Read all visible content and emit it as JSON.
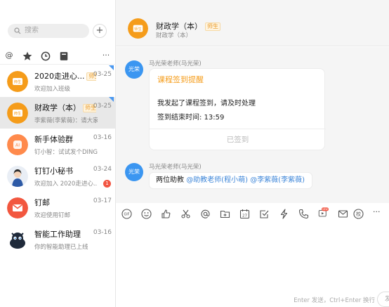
{
  "search": {
    "placeholder": "搜索"
  },
  "add_button": "+",
  "filters": {
    "more": "···"
  },
  "conversations": [
    {
      "name": "2020走进心...",
      "tag": "师生",
      "date": "03-25",
      "preview": "欢迎加入班级"
    },
    {
      "name": "财政学（本）",
      "tag": "师生",
      "date": "03-25",
      "preview": "李紫薇(李紫薇)：请大家..."
    },
    {
      "name": "新手体验群",
      "date": "03-16",
      "preview": "钉小智：试试发个DING",
      "avatar_text": "AI"
    },
    {
      "name": "钉钉小秘书",
      "date": "03-24",
      "preview": "欢迎加入 2020走进心...",
      "unread": "1"
    },
    {
      "name": "钉邮",
      "date": "03-17",
      "preview": "欢迎使用钉邮"
    },
    {
      "name": "智能工作助理",
      "date": "03-16",
      "preview": "你的智能助理已上线"
    }
  ],
  "header": {
    "title": "财政学（本）",
    "tag": "师生",
    "subtitle": "财政学（本）"
  },
  "messages": [
    {
      "avatar": "光荣",
      "sender": "马光荣老师(马光荣)",
      "card": {
        "title": "课程签到提醒",
        "line1": "我发起了课程签到，请及时处理",
        "line2": "签到结束时间: 13:59",
        "button": "已签到"
      }
    },
    {
      "avatar": "光荣",
      "sender": "马光荣老师(马光荣)",
      "text": "两位助教",
      "mention1": "@助教老师(程小萌)",
      "mention2": "@李紫薇(李紫薇)"
    }
  ],
  "toolbar": {
    "gif": "GIF",
    "calendar": "27",
    "new_badge": "NEW",
    "more": "···"
  },
  "input": {
    "hint": "Enter 发送，Ctrl+Enter 换行",
    "send": "发"
  },
  "colors": {
    "accent_orange": "#f59c1a",
    "blue": "#3b96f1",
    "unread": "#f25643",
    "mention": "#3c85d8"
  }
}
